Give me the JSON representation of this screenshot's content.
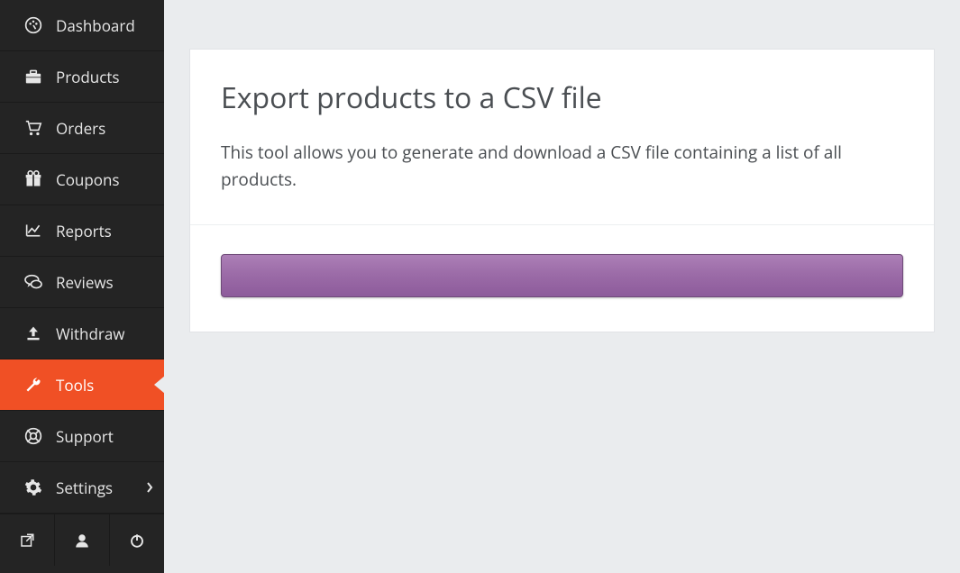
{
  "sidebar": {
    "items": [
      {
        "label": "Dashboard",
        "icon": "dashboard"
      },
      {
        "label": "Products",
        "icon": "briefcase"
      },
      {
        "label": "Orders",
        "icon": "cart"
      },
      {
        "label": "Coupons",
        "icon": "gift"
      },
      {
        "label": "Reports",
        "icon": "chart"
      },
      {
        "label": "Reviews",
        "icon": "comments"
      },
      {
        "label": "Withdraw",
        "icon": "upload"
      },
      {
        "label": "Tools",
        "icon": "wrench",
        "active": true
      },
      {
        "label": "Support",
        "icon": "life-ring"
      },
      {
        "label": "Settings",
        "icon": "gear",
        "chevron": true
      }
    ]
  },
  "main": {
    "title": "Export products to a CSV file",
    "description": "This tool allows you to generate and download a CSV file containing a list of all products."
  }
}
